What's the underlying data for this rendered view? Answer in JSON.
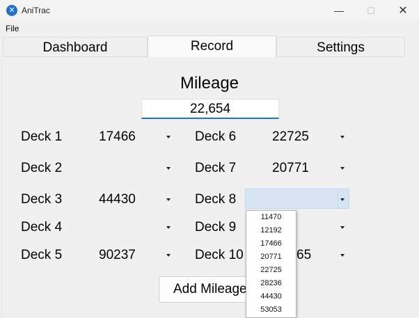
{
  "window": {
    "title": "AniTrac",
    "icon": "app-logo-icon",
    "minimize_glyph": "—",
    "maximize_glyph": "☐",
    "close_glyph": "✕"
  },
  "menu": {
    "file": "File"
  },
  "tabs": [
    {
      "label": "Dashboard",
      "active": false
    },
    {
      "label": "Record",
      "active": true
    },
    {
      "label": "Settings",
      "active": false
    }
  ],
  "mileage": {
    "label": "Mileage",
    "value": "22,654"
  },
  "decks": [
    {
      "label": "Deck 1",
      "value": "17466"
    },
    {
      "label": "Deck 2",
      "value": ""
    },
    {
      "label": "Deck 3",
      "value": "44430"
    },
    {
      "label": "Deck 4",
      "value": ""
    },
    {
      "label": "Deck 5",
      "value": "90237"
    },
    {
      "label": "Deck 6",
      "value": "22725"
    },
    {
      "label": "Deck 7",
      "value": "20771"
    },
    {
      "label": "Deck 8",
      "value": ""
    },
    {
      "label": "Deck 9",
      "value": ""
    },
    {
      "label": "Deck 10",
      "value": "65"
    }
  ],
  "dropdown": {
    "options": [
      "11470",
      "12192",
      "17466",
      "20771",
      "22725",
      "28236",
      "44430",
      "53053"
    ]
  },
  "actions": {
    "add_mileage": "Add Mileage"
  },
  "colors": {
    "accent": "#1f6fd1",
    "combo_open_bg": "#d7e5f3"
  }
}
